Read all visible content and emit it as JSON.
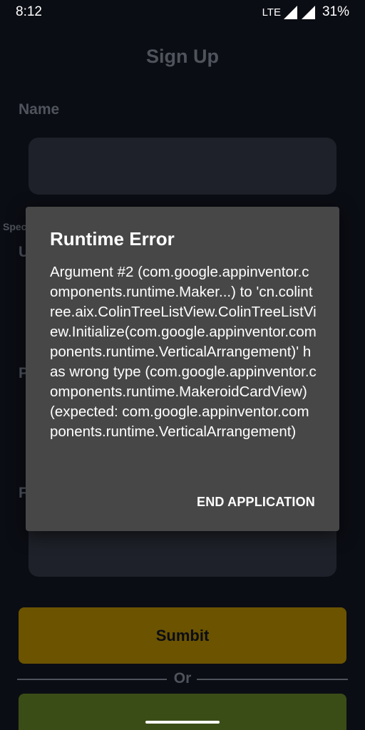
{
  "status_bar": {
    "time": "8:12",
    "network": "LTE",
    "battery": "31%"
  },
  "page": {
    "title": "Sign Up",
    "name_label": "Name",
    "peek_text": "Spec",
    "peek_letter_1": "U",
    "peek_letter_2": "P",
    "peek_letter_3": "F",
    "submit_label": "Sumbit",
    "or_label": "Or"
  },
  "dialog": {
    "title": "Runtime Error",
    "message": "Argument #2 (com.google.appinventor.components.runtime.Maker...) to 'cn.colintree.aix.ColinTreeListView.ColinTreeListView.Initialize(com.google.appinventor.components.runtime.VerticalArrangement)' has wrong type (com.google.appinventor.components.runtime.MakeroidCardView) (expected: com.google.appinventor.components.runtime.VerticalArrangement)",
    "button_label": "END APPLICATION"
  },
  "colors": {
    "background": "#0b0d14",
    "dialog": "#474747",
    "submit": "#6b5300",
    "secondary_button": "#3b4d17"
  }
}
